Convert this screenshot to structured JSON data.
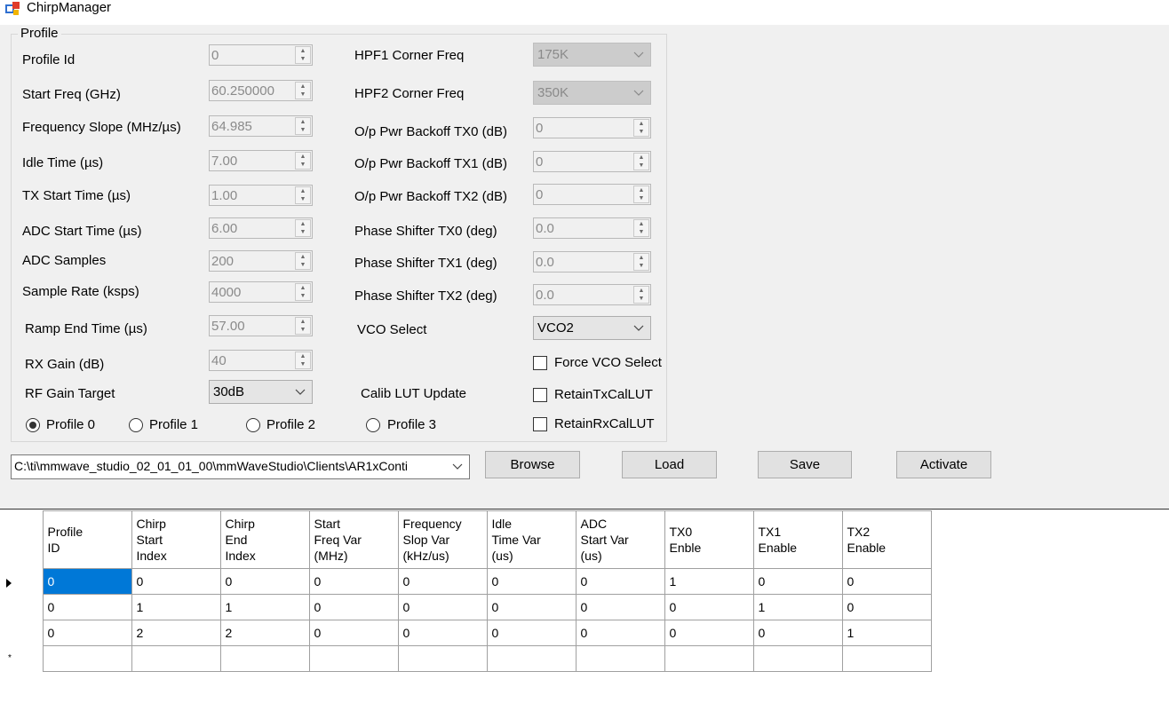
{
  "window": {
    "title": "ChirpManager"
  },
  "profile_group": {
    "legend": "Profile"
  },
  "left_fields": [
    {
      "label": "Profile Id",
      "value": "0"
    },
    {
      "label": "Start Freq (GHz)",
      "value": "60.250000"
    },
    {
      "label": "Frequency Slope (MHz/µs)",
      "value": "64.985"
    },
    {
      "label": "Idle Time (µs)",
      "value": "7.00"
    },
    {
      "label": "TX Start Time (µs)",
      "value": "1.00"
    },
    {
      "label": "ADC Start Time (µs)",
      "value": "6.00"
    },
    {
      "label": "ADC Samples",
      "value": "200"
    },
    {
      "label": "Sample Rate (ksps)",
      "value": "4000"
    },
    {
      "label": "Ramp End Time (µs)",
      "value": "57.00"
    },
    {
      "label": "RX Gain (dB)",
      "value": "40"
    }
  ],
  "rf_gain": {
    "label": "RF Gain Target",
    "value": "30dB"
  },
  "hpf1": {
    "label": "HPF1 Corner Freq",
    "value": "175K"
  },
  "hpf2": {
    "label": "HPF2 Corner Freq",
    "value": "350K"
  },
  "right_fields": [
    {
      "label": "O/p Pwr Backoff TX0 (dB)",
      "value": "0"
    },
    {
      "label": "O/p Pwr Backoff TX1 (dB)",
      "value": "0"
    },
    {
      "label": "O/p Pwr Backoff TX2 (dB)",
      "value": "0"
    },
    {
      "label": "Phase Shifter TX0 (deg)",
      "value": "0.0"
    },
    {
      "label": "Phase Shifter TX1 (deg)",
      "value": "0.0"
    },
    {
      "label": "Phase Shifter TX2 (deg)",
      "value": "0.0"
    }
  ],
  "vco": {
    "label": "VCO Select",
    "value": "VCO2"
  },
  "force_vco": {
    "label": "Force VCO Select",
    "checked": false
  },
  "calib": {
    "label": "Calib LUT Update"
  },
  "retain_tx": {
    "label": "RetainTxCalLUT",
    "checked": false
  },
  "retain_rx": {
    "label": "RetainRxCalLUT",
    "checked": false
  },
  "profiles": [
    {
      "label": "Profile 0",
      "selected": true
    },
    {
      "label": "Profile 1",
      "selected": false
    },
    {
      "label": "Profile 2",
      "selected": false
    },
    {
      "label": "Profile 3",
      "selected": false
    }
  ],
  "path": {
    "value": "C:\\ti\\mmwave_studio_02_01_01_00\\mmWaveStudio\\Clients\\AR1xConti"
  },
  "buttons": {
    "browse": "Browse",
    "load": "Load",
    "save": "Save",
    "activate": "Activate"
  },
  "table": {
    "headers": [
      [
        "Profile",
        "ID"
      ],
      [
        "Chirp",
        "Start",
        "Index"
      ],
      [
        "Chirp",
        "End",
        "Index"
      ],
      [
        "Start",
        "Freq Var",
        "(MHz)"
      ],
      [
        "Frequency",
        "Slop Var",
        "(kHz/us)"
      ],
      [
        "Idle",
        "Time Var",
        "(us)"
      ],
      [
        "ADC",
        "Start Var",
        "(us)"
      ],
      [
        "TX0",
        "Enble"
      ],
      [
        "TX1",
        "Enable"
      ],
      [
        "TX2",
        "Enable"
      ]
    ],
    "rows": [
      [
        "0",
        "0",
        "0",
        "0",
        "0",
        "0",
        "0",
        "1",
        "0",
        "0"
      ],
      [
        "0",
        "1",
        "1",
        "0",
        "0",
        "0",
        "0",
        "0",
        "1",
        "0"
      ],
      [
        "0",
        "2",
        "2",
        "0",
        "0",
        "0",
        "0",
        "0",
        "0",
        "1"
      ]
    ],
    "new_row_marker": "*"
  },
  "colors": {
    "selection": "#0078d7",
    "panel": "#f0f0f0"
  }
}
